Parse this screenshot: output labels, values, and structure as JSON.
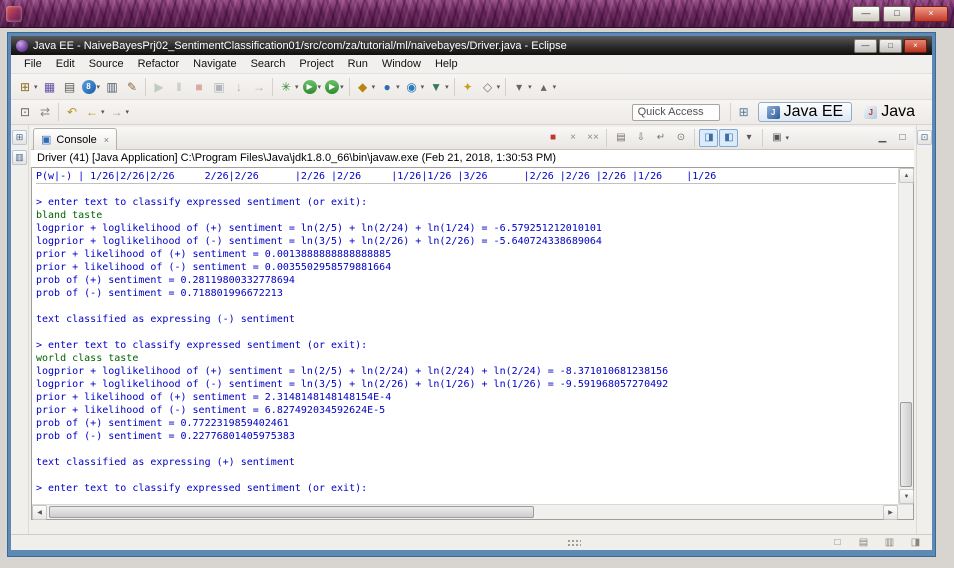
{
  "outer": {
    "controls": {
      "minimize": "—",
      "maximize": "□",
      "close": "×"
    }
  },
  "eclipse": {
    "title": "Java EE - NaiveBayesPrj02_SentimentClassification01/src/com/za/tutorial/ml/naivebayes/Driver.java - Eclipse",
    "controls": {
      "minimize": "—",
      "maximize": "□",
      "close": "×"
    }
  },
  "menu": {
    "items": [
      "File",
      "Edit",
      "Source",
      "Refactor",
      "Navigate",
      "Search",
      "Project",
      "Run",
      "Window",
      "Help"
    ]
  },
  "toolbar_main": {
    "buttons": [
      {
        "name": "new-wizard",
        "glyph": "⊞",
        "color": "#8a6d1d",
        "dropdown": true
      },
      {
        "name": "save",
        "glyph": "▦",
        "color": "#5f51a5"
      },
      {
        "name": "print",
        "glyph": "▤",
        "color": "#5a5a5a"
      },
      {
        "name": "debug-update",
        "glyph": "8",
        "color": "#ffffff",
        "bg": "linear-gradient(135deg,#5aa0e0,#1a5dab)",
        "dropdown": true,
        "bold": true
      },
      {
        "name": "open-console-view",
        "glyph": "▥",
        "color": "#46586a"
      },
      {
        "name": "new-snippet",
        "glyph": "✎",
        "color": "#8a6a3a"
      },
      {
        "sep": true
      },
      {
        "name": "resume",
        "glyph": "▶",
        "color": "#7f9f7f",
        "disabled": true
      },
      {
        "name": "suspend",
        "glyph": "‖",
        "color": "#556677",
        "disabled": true
      },
      {
        "name": "terminate-launch",
        "glyph": "■",
        "color": "#c04a3a",
        "disabled": true
      },
      {
        "name": "disconnect",
        "glyph": "▣",
        "color": "#556677",
        "disabled": true
      },
      {
        "name": "step-into",
        "glyph": "↓",
        "color": "#556677",
        "disabled": true
      },
      {
        "name": "step-over",
        "glyph": "→",
        "color": "#556677",
        "disabled": true
      },
      {
        "sep": true
      },
      {
        "name": "debug",
        "glyph": "✳",
        "color": "#3a8a3a",
        "dropdown": true
      },
      {
        "name": "run",
        "glyph": "▶",
        "color": "#ffffff",
        "bg": "linear-gradient(#6cc26c,#2e8b2e)",
        "dropdown": true
      },
      {
        "name": "external-tools",
        "glyph": "▶",
        "color": "#ffffff",
        "bg": "linear-gradient(#6cc26c,#2e8b2e)",
        "dropdown": true
      },
      {
        "sep": true
      },
      {
        "name": "new-servlet",
        "glyph": "◆",
        "color": "#b8860b",
        "dropdown": true
      },
      {
        "name": "new-session-bean",
        "glyph": "●",
        "color": "#2e6db4",
        "dropdown": true
      },
      {
        "name": "new-web-service",
        "glyph": "◉",
        "color": "#2b7bbf",
        "dropdown": true
      },
      {
        "name": "new-database-connection",
        "glyph": "▼",
        "color": "#3a7a5a",
        "dropdown": true
      },
      {
        "sep": true
      },
      {
        "name": "search",
        "glyph": "✦",
        "color": "#c8a21a"
      },
      {
        "name": "open-element",
        "glyph": "◇",
        "color": "#777777",
        "dropdown": true
      },
      {
        "sep": true
      },
      {
        "name": "next-annotation",
        "glyph": "▾",
        "color": "#666666",
        "dropdown": true
      },
      {
        "name": "previous-annotation",
        "glyph": "▴",
        "color": "#666666",
        "dropdown": true
      }
    ]
  },
  "toolbar_nav": {
    "buttons": [
      {
        "name": "pin-editor",
        "glyph": "⊡",
        "color": "#666666"
      },
      {
        "name": "link-with-editor",
        "glyph": "⇄",
        "color": "#888888"
      },
      {
        "sep": true
      },
      {
        "name": "last-edit-location",
        "glyph": "↶",
        "color": "#b8941f"
      },
      {
        "name": "back",
        "glyph": "←",
        "color": "#b8941f",
        "dropdown": true
      },
      {
        "name": "forward",
        "glyph": "→",
        "color": "#9aa4ad",
        "dropdown": true
      }
    ],
    "quick_access": "Quick Access",
    "open_perspective_glyph": "⊞",
    "perspectives": [
      {
        "id": "javaee",
        "label": "Java EE",
        "icon_glyph": "J",
        "active": true
      },
      {
        "id": "java",
        "label": "Java",
        "icon_glyph": "J",
        "active": false
      }
    ]
  },
  "left_strip": {
    "buttons": [
      {
        "name": "restore-project-explorer-view",
        "glyph": "⊞",
        "color": "#44658c"
      },
      {
        "name": "restore-servers-view",
        "glyph": "▥",
        "color": "#44658c"
      }
    ]
  },
  "right_strip": {
    "buttons": [
      {
        "name": "restore-outline-view",
        "glyph": "⊡",
        "color": "#44658c"
      }
    ]
  },
  "console": {
    "tab": "Console",
    "description": "Driver (41) [Java Application] C:\\Program Files\\Java\\jdk1.8.0_66\\bin\\javaw.exe (Feb 21, 2018, 1:30:53 PM)",
    "toolbar": [
      {
        "name": "terminate",
        "glyph": "■",
        "color": "#c3352b"
      },
      {
        "name": "remove-launch",
        "glyph": "×",
        "color": "#8a8a8a"
      },
      {
        "name": "remove-all-terminated",
        "glyph": "××",
        "color": "#8a8a8a"
      },
      {
        "sep": true
      },
      {
        "name": "clear-console",
        "glyph": "▤",
        "color": "#76716b"
      },
      {
        "name": "scroll-lock",
        "glyph": "⇩",
        "color": "#76716b"
      },
      {
        "name": "word-wrap",
        "glyph": "↵",
        "color": "#76716b"
      },
      {
        "name": "pin-console",
        "glyph": "⊙",
        "color": "#76716b"
      },
      {
        "sep": true
      },
      {
        "name": "show-on-stdout-change",
        "glyph": "◨",
        "color": "#3a6ea5",
        "toggled": true
      },
      {
        "name": "show-on-stderr-change",
        "glyph": "◧",
        "color": "#3a6ea5",
        "toggled": true
      },
      {
        "name": "display-selected-console",
        "glyph": "▾",
        "color": "#555555"
      },
      {
        "sep": true
      },
      {
        "name": "open-console",
        "glyph": "▣",
        "color": "#555555",
        "dropdown": true
      },
      {
        "spacer": true
      },
      {
        "name": "minimize-view",
        "glyph": "▁",
        "color": "#555555"
      },
      {
        "name": "maximize-view",
        "glyph": "□",
        "color": "#555555"
      }
    ],
    "lines": [
      {
        "kind": "out",
        "text": "P(w|-) | 1/26|2/26|2/26     2/26|2/26      |2/26 |2/26     |1/26|1/26 |3/26      |2/26 |2/26 |2/26 |1/26    |1/26"
      },
      {
        "kind": "rule",
        "text": ""
      },
      {
        "kind": "out",
        "text": "> enter text to classify expressed sentiment (or exit):"
      },
      {
        "kind": "in",
        "text": "bland taste"
      },
      {
        "kind": "out",
        "text": "logprior + loglikelihood of (+) sentiment = ln(2/5) + ln(2/24) + ln(1/24) = -6.579251212010101"
      },
      {
        "kind": "out",
        "text": "logprior + loglikelihood of (-) sentiment = ln(3/5) + ln(2/26) + ln(2/26) = -5.640724338689064"
      },
      {
        "kind": "out",
        "text": "prior + likelihood of (+) sentiment = 0.0013888888888888885"
      },
      {
        "kind": "out",
        "text": "prior + likelihood of (-) sentiment = 0.0035502958579881664"
      },
      {
        "kind": "out",
        "text": "prob of (+) sentiment = 0.28119800332778694"
      },
      {
        "kind": "out",
        "text": "prob of (-) sentiment = 0.718801996672213"
      },
      {
        "kind": "blank",
        "text": ""
      },
      {
        "kind": "out",
        "text": "text classified as expressing (-) sentiment"
      },
      {
        "kind": "blank",
        "text": ""
      },
      {
        "kind": "out",
        "text": "> enter text to classify expressed sentiment (or exit):"
      },
      {
        "kind": "in",
        "text": "world class taste"
      },
      {
        "kind": "out",
        "text": "logprior + loglikelihood of (+) sentiment = ln(2/5) + ln(2/24) + ln(2/24) + ln(2/24) = -8.371010681238156"
      },
      {
        "kind": "out",
        "text": "logprior + loglikelihood of (-) sentiment = ln(3/5) + ln(2/26) + ln(1/26) + ln(1/26) = -9.591968057270492"
      },
      {
        "kind": "out",
        "text": "prior + likelihood of (+) sentiment = 2.3148148148148154E-4"
      },
      {
        "kind": "out",
        "text": "prior + likelihood of (-) sentiment = 6.827492034592624E-5"
      },
      {
        "kind": "out",
        "text": "prob of (+) sentiment = 0.7722319859402461"
      },
      {
        "kind": "out",
        "text": "prob of (-) sentiment = 0.22776801405975383"
      },
      {
        "kind": "blank",
        "text": ""
      },
      {
        "kind": "out",
        "text": "text classified as expressing (+) sentiment"
      },
      {
        "kind": "blank",
        "text": ""
      },
      {
        "kind": "out",
        "text": "> enter text to classify expressed sentiment (or exit):"
      }
    ],
    "colors": {
      "stdout": "#0000c4",
      "stdin": "#006400"
    }
  },
  "statusbar": {
    "buttons": [
      {
        "name": "editor-presentation",
        "glyph": "□",
        "color": "#8a857e"
      },
      {
        "name": "background-jobs",
        "glyph": "▤",
        "color": "#8a857e"
      },
      {
        "name": "heap-status",
        "glyph": "▥",
        "color": "#8a857e"
      },
      {
        "name": "notifications",
        "glyph": "◨",
        "color": "#8a857e"
      }
    ]
  }
}
